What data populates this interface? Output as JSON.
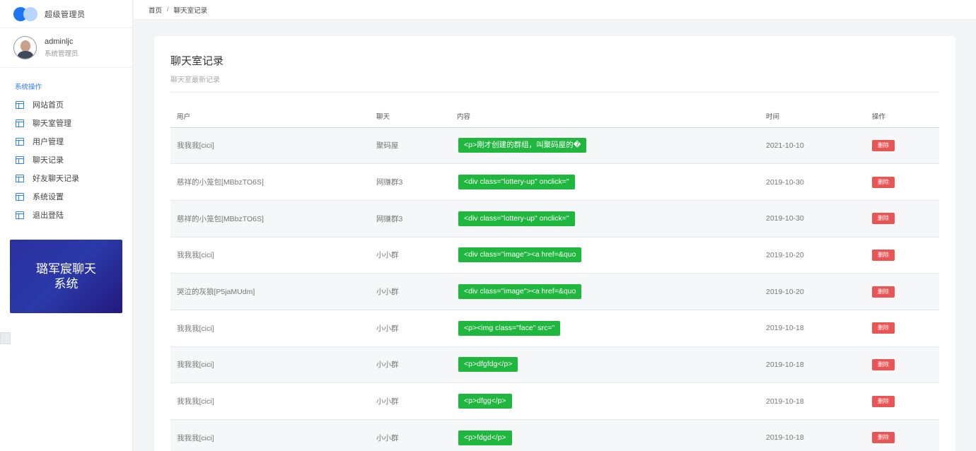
{
  "brand": {
    "title": "超级管理员"
  },
  "user": {
    "name": "adminljc",
    "role": "系统管理员"
  },
  "sidebar": {
    "section": "系统操作",
    "items": [
      {
        "label": "网站首页"
      },
      {
        "label": "聊天室管理"
      },
      {
        "label": "用户管理"
      },
      {
        "label": "聊天记录"
      },
      {
        "label": "好友聊天记录"
      },
      {
        "label": "系统设置"
      },
      {
        "label": "退出登陆"
      }
    ],
    "promo": "璐军宸聊天系统"
  },
  "breadcrumb": {
    "home": "首页",
    "separator": "/",
    "current": "聊天室记录"
  },
  "card": {
    "title": "聊天室记录",
    "subtitle": "聊天室最新记录"
  },
  "table": {
    "headers": {
      "user": "用户",
      "chat": "聊天",
      "content": "内容",
      "time": "时间",
      "op": "操作"
    },
    "rows": [
      {
        "user": "我我我[cici]",
        "chat": "聚码屋",
        "content": "<p>刚才创建的群组，叫聚码屋的�",
        "time": "2021-10-10",
        "op": "删除"
      },
      {
        "user": "慈祥的小笼包[MBbzTO6S]",
        "chat": "网赚群3",
        "content": "<div class=\"lottery-up\" onclick=\"",
        "time": "2019-10-30",
        "op": "删除"
      },
      {
        "user": "慈祥的小笼包[MBbzTO6S]",
        "chat": "网赚群3",
        "content": "<div class=\"lottery-up\" onclick=\"",
        "time": "2019-10-30",
        "op": "删除"
      },
      {
        "user": "我我我[cici]",
        "chat": "小小群",
        "content": "<div class=\"image\"><a href=&quo",
        "time": "2019-10-20",
        "op": "删除"
      },
      {
        "user": "哭泣的灰狼[P5jaMUdm]",
        "chat": "小小群",
        "content": "<div class=\"image\"><a href=&quo",
        "time": "2019-10-20",
        "op": "删除"
      },
      {
        "user": "我我我[cici]",
        "chat": "小小群",
        "content": "<p><img class=\"face\" src=\"",
        "time": "2019-10-18",
        "op": "删除"
      },
      {
        "user": "我我我[cici]",
        "chat": "小小群",
        "content": "<p>dfgfdg</p>",
        "time": "2019-10-18",
        "op": "删除"
      },
      {
        "user": "我我我[cici]",
        "chat": "小小群",
        "content": "<p>dfgg</p>",
        "time": "2019-10-18",
        "op": "删除"
      },
      {
        "user": "我我我[cici]",
        "chat": "小小群",
        "content": "<p>fdgd</p>",
        "time": "2019-10-18",
        "op": "删除"
      }
    ]
  },
  "colors": {
    "accent": "#2f7ef7",
    "tag": "#1fb73e",
    "danger": "#e95454",
    "promo": "#2a2fa0"
  }
}
